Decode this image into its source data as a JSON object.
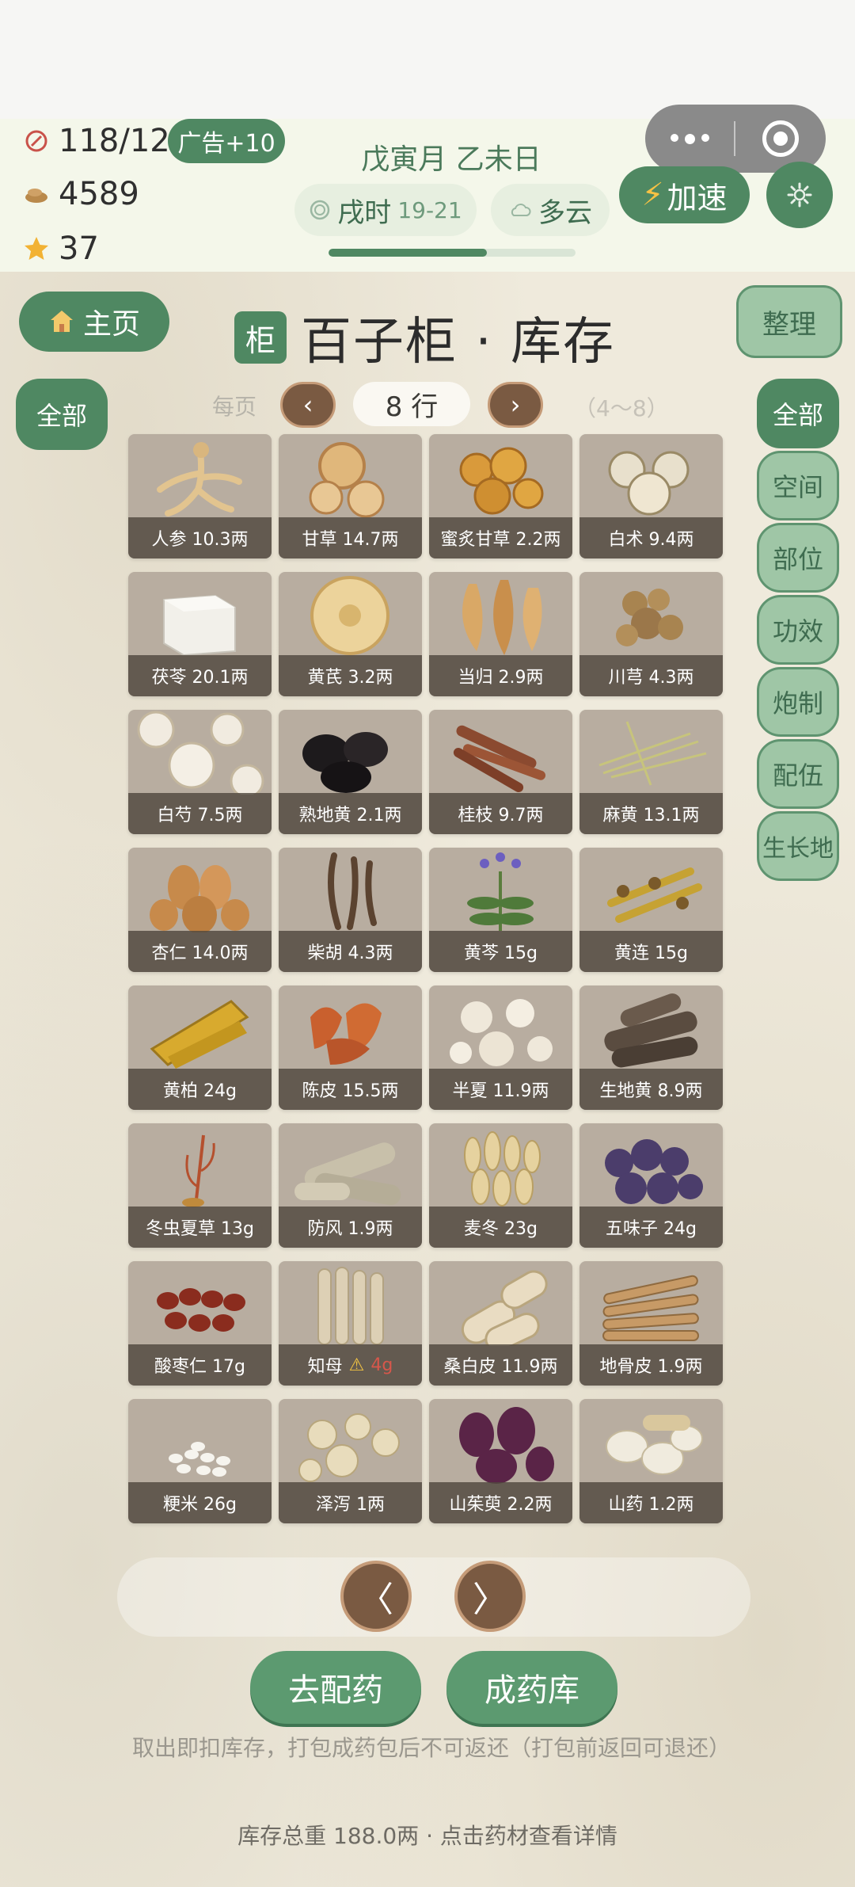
{
  "top": {
    "energy": "118/120",
    "coins": "4589",
    "stars": "37",
    "ad_button": "广告+10",
    "date": "戊寅月 乙未日",
    "time_label": "戌时",
    "time_range": "19-21",
    "weather": "多云",
    "speed_button": "加速",
    "progress": 0.64
  },
  "header": {
    "home_button": "主页",
    "badge": "柜",
    "title": "百子柜 · 库存",
    "sort_button": "整理"
  },
  "pager": {
    "left_filter": "全部",
    "per_page_label": "每页",
    "rows_value": "8 行",
    "range_label": "（4～8）",
    "prev": "‹",
    "next": "›"
  },
  "filters": [
    {
      "label": "全部",
      "active": true
    },
    {
      "label": "空间",
      "active": false
    },
    {
      "label": "部位",
      "active": false
    },
    {
      "label": "功效",
      "active": false
    },
    {
      "label": "炮制",
      "active": false
    },
    {
      "label": "配伍",
      "active": false
    },
    {
      "label": "生长地",
      "active": false
    }
  ],
  "herbs": [
    {
      "label": "人参 10.3两",
      "icon": "ginseng"
    },
    {
      "label": "甘草 14.7两",
      "icon": "slices"
    },
    {
      "label": "蜜炙甘草 2.2两",
      "icon": "honey-slices"
    },
    {
      "label": "白术 9.4两",
      "icon": "slices-light"
    },
    {
      "label": "茯苓 20.1两",
      "icon": "cube"
    },
    {
      "label": "黄芪 3.2两",
      "icon": "big-slice"
    },
    {
      "label": "当归 2.9两",
      "icon": "curled-slices"
    },
    {
      "label": "川芎 4.3两",
      "icon": "knobby-root"
    },
    {
      "label": "白芍 7.5两",
      "icon": "white-slices"
    },
    {
      "label": "熟地黄 2.1两",
      "icon": "black-chunks"
    },
    {
      "label": "桂枝 9.7两",
      "icon": "sticks"
    },
    {
      "label": "麻黄 13.1两",
      "icon": "grass-stems"
    },
    {
      "label": "杏仁 14.0两",
      "icon": "almonds"
    },
    {
      "label": "柴胡 4.3两",
      "icon": "thin-roots"
    },
    {
      "label": "黄芩 15g",
      "icon": "purple-flower"
    },
    {
      "label": "黄连 15g",
      "icon": "yellow-roots"
    },
    {
      "label": "黄柏 24g",
      "icon": "bark-yellow"
    },
    {
      "label": "陈皮 15.5两",
      "icon": "orange-peel"
    },
    {
      "label": "半夏 11.9两",
      "icon": "white-tubers"
    },
    {
      "label": "生地黄 8.9两",
      "icon": "dark-roots"
    },
    {
      "label": "冬虫夏草 13g",
      "icon": "cordyceps"
    },
    {
      "label": "防风 1.9两",
      "icon": "grey-roots"
    },
    {
      "label": "麦冬 23g",
      "icon": "tuber-pile"
    },
    {
      "label": "五味子 24g",
      "icon": "purple-berries"
    },
    {
      "label": "酸枣仁 17g",
      "icon": "red-seeds"
    },
    {
      "label": "知母",
      "warn": "⚠",
      "warn_value": "4g",
      "icon": "pale-roots"
    },
    {
      "label": "桑白皮 11.9两",
      "icon": "bark-rolls"
    },
    {
      "label": "地骨皮 1.9两",
      "icon": "bark-tubes"
    },
    {
      "label": "粳米 26g",
      "icon": "rice"
    },
    {
      "label": "泽泻 1两",
      "icon": "round-tubers"
    },
    {
      "label": "山茱萸 2.2两",
      "icon": "dark-berries"
    },
    {
      "label": "山药 1.2两",
      "icon": "yam-slices"
    }
  ],
  "bottom": {
    "prev_page": "〈",
    "next_page": "〉",
    "dispense_button": "去配药",
    "finished_button": "成药库",
    "note": "取出即扣库存，打包成药包后不可返还（打包前返回可退还）",
    "footer": "库存总重 188.0两 · 点击药材查看详情"
  },
  "colors": {
    "accent": "#4f8862",
    "wood": "#7a5a42",
    "tile": "#b8ada0"
  }
}
